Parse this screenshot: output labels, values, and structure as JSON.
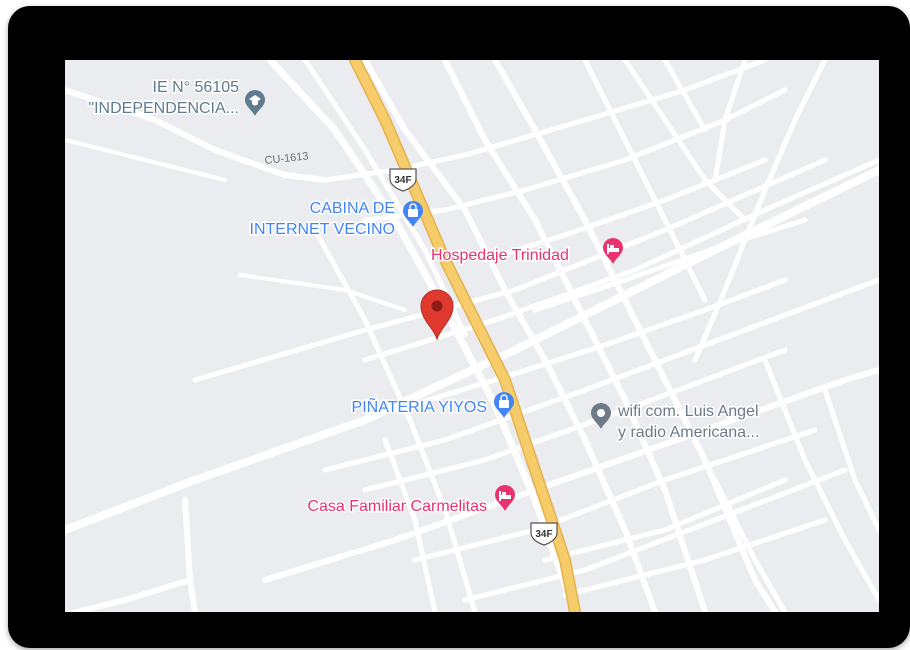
{
  "map": {
    "colors": {
      "background": "#eaecef",
      "street": "#ffffff",
      "highway_fill": "#f6cc6a",
      "highway_edge": "#e4b24e",
      "education": "#5f7c8e",
      "shopping": "#4285f4",
      "lodging": "#e8336f",
      "generic": "#6c7b87",
      "selected_marker": "#e03a2f"
    },
    "road_label": "CU-1613",
    "highway_shields": [
      {
        "label": "34F"
      },
      {
        "label": "34F"
      }
    ],
    "pois": [
      {
        "id": "ie-56105",
        "lines": [
          "IE N° 56105",
          "\"INDEPENDENCIA..."
        ],
        "category": "education",
        "icon": "graduation-cap-icon"
      },
      {
        "id": "cabina-internet",
        "lines": [
          "CABINA DE",
          "INTERNET VECINO"
        ],
        "category": "shopping",
        "icon": "shopping-bag-icon"
      },
      {
        "id": "hospedaje-trinidad",
        "lines": [
          "Hospedaje Trinidad"
        ],
        "category": "lodging",
        "icon": "bed-icon"
      },
      {
        "id": "pinateria-yiyos",
        "lines": [
          "PIÑATERIA YIYOS"
        ],
        "category": "shopping",
        "icon": "shopping-bag-icon"
      },
      {
        "id": "wifi-luis-angel",
        "lines": [
          "wifi com. Luis Angel",
          "y radio Americana..."
        ],
        "category": "generic",
        "icon": "place-marker-icon"
      },
      {
        "id": "casa-carmelitas",
        "lines": [
          "Casa Familiar Carmelitas"
        ],
        "category": "lodging",
        "icon": "bed-icon"
      }
    ],
    "selected_marker": {
      "icon": "red-location-pin-icon"
    }
  }
}
